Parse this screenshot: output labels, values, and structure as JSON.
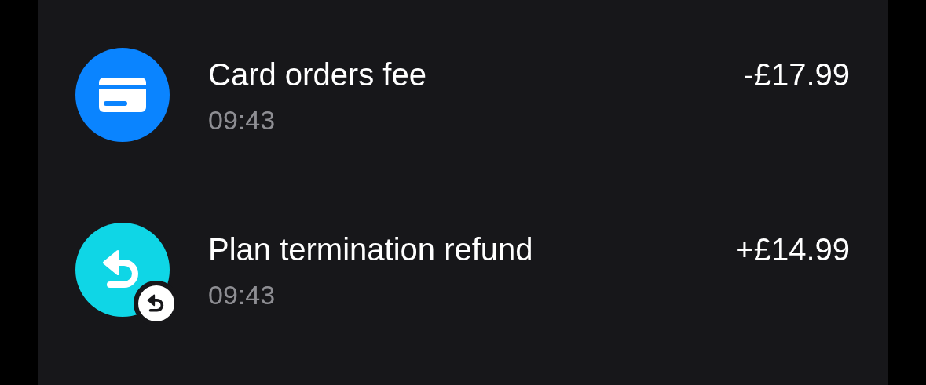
{
  "transactions": [
    {
      "kind": "card",
      "color": "#0a84ff",
      "badge": false,
      "title": "Card orders fee",
      "time": "09:43",
      "amount": "-£17.99"
    },
    {
      "kind": "refund",
      "color": "#0fd6e6",
      "badge": true,
      "title": "Plan termination refund",
      "time": "09:43",
      "amount": "+£14.99"
    }
  ]
}
